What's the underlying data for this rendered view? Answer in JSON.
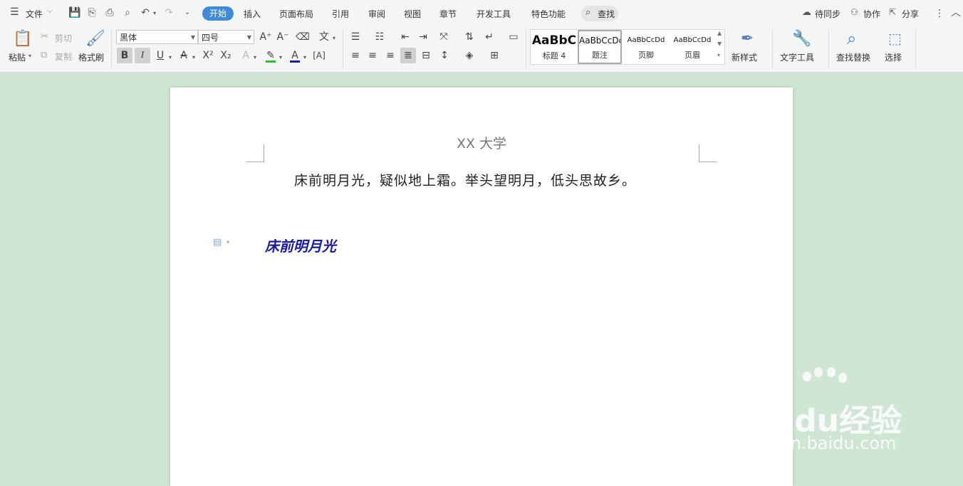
{
  "menubar": {
    "file_label": "文件",
    "tabs": [
      "开始",
      "插入",
      "页面布局",
      "引用",
      "审阅",
      "视图",
      "章节",
      "开发工具",
      "特色功能"
    ],
    "active_tab": "开始",
    "search_label": "查找",
    "right": {
      "sync": "待同步",
      "collab": "协作",
      "share": "分享"
    }
  },
  "ribbon": {
    "paste": "粘贴",
    "cut": "剪切",
    "copy": "复制",
    "format_painter": "格式刷",
    "font_name": "黑体",
    "font_size": "四号",
    "styles": [
      {
        "preview": "AaBbC",
        "name": "标题 4"
      },
      {
        "preview": "AaBbCcDd",
        "name": "题注"
      },
      {
        "preview": "AaBbCcDd",
        "name": "页脚"
      },
      {
        "preview": "AaBbCcDd",
        "name": "页眉"
      }
    ],
    "new_style": "新样式",
    "text_tools": "文字工具",
    "find_replace": "查找替换",
    "select": "选择"
  },
  "document": {
    "header": "XX 大学",
    "body": "床前明月光，疑似地上霜。举头望明月，低头思故乡。",
    "heading": "床前明月光"
  },
  "watermark": {
    "logo": "Baidu经验",
    "url": "jingyan.baidu.com"
  },
  "colors": {
    "accent": "#3f8bd8",
    "background": "#cfe6d5",
    "heading": "#1a1aa0",
    "highlight": "#22c322",
    "font_color": "#1a1aa0"
  }
}
